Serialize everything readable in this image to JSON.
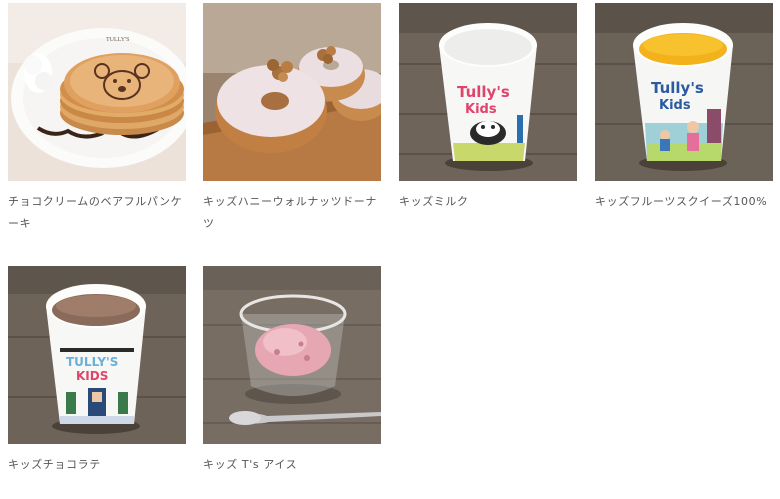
{
  "menu": {
    "items": [
      {
        "name": "チョコクリームのベアフルパンケーキ",
        "image": "pancake-photo"
      },
      {
        "name": "キッズハニーウォルナッツドーナツ",
        "image": "donut-photo"
      },
      {
        "name": "キッズミルク",
        "image": "milk-cup-photo"
      },
      {
        "name": "キッズフルーツスクイーズ100%",
        "image": "juice-cup-photo"
      },
      {
        "name": "キッズチョコラテ",
        "image": "chocolate-latte-cup-photo"
      },
      {
        "name": "キッズ T's アイス",
        "image": "ice-cream-photo"
      }
    ],
    "cup_text": {
      "tullys": "Tully's",
      "kids": "Kids",
      "tullys_caps": "TULLY'S",
      "kids_caps": "KIDS"
    },
    "plate_text": "TULLY'S"
  }
}
